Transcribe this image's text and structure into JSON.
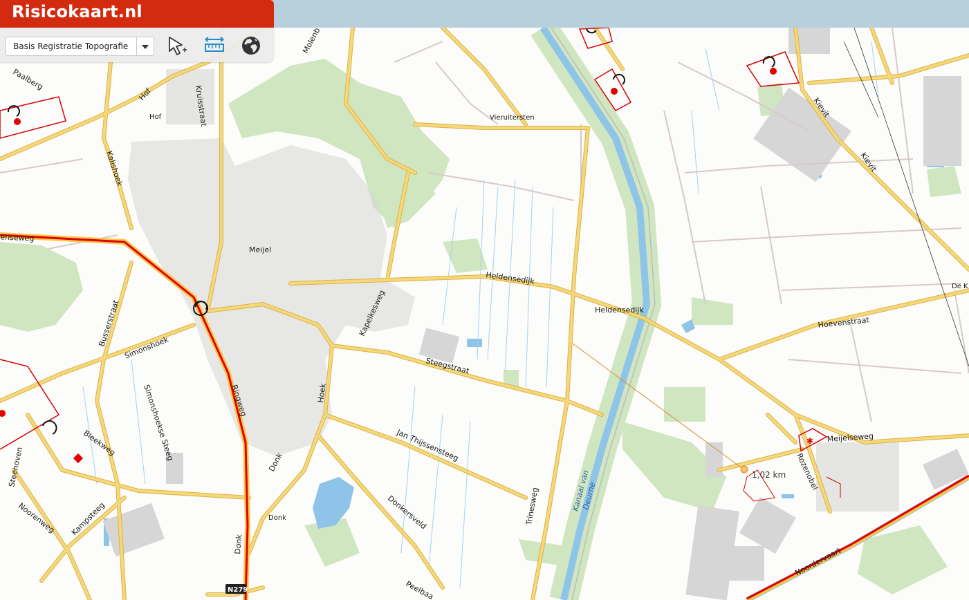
{
  "app": {
    "title": "Risicokaart.nl"
  },
  "toolbar": {
    "layer_select": {
      "value": "Basis Registratie Topografie"
    },
    "tools": [
      {
        "name": "select-tool",
        "icon": "cursor-select-icon"
      },
      {
        "name": "measure-tool",
        "icon": "ruler-measure-icon"
      },
      {
        "name": "globe-tool",
        "icon": "globe-icon"
      }
    ]
  },
  "map": {
    "colors": {
      "road_major": "#f6d77a",
      "road_outline": "#d9b347",
      "risk_route": "#e30000",
      "risk_zone": "#d40000",
      "water": "#8ec4e8",
      "forest": "#cfe6c0",
      "built": "#d6d6d6",
      "measure": "#e08a2a"
    },
    "places": {
      "meijel": "Meijel",
      "hof": "Hof",
      "donk": "Donk",
      "vieruitersten": "Vieruitersten",
      "de_k": "De K"
    },
    "streets": {
      "paalberg": "Paalberg",
      "hof": "Hof",
      "kruisstraat": "Kruisstraat",
      "molenb": "Molenb",
      "kalishoek": "Kalishoek",
      "tenseweg": "tenseweg",
      "busserstraat": "Busserstraat",
      "simonshoek": "Simonshoek",
      "simonshoekse_steeg": "Simonshoekse Steeg",
      "bleekweg": "Bleekweg",
      "steenoven": "Steenoven",
      "noorenweg": "Noorenweg",
      "kampsteeg": "Kampsteeg",
      "ringweg": "Ringweg",
      "donk_road": "Donk",
      "donk_road2": "Donk",
      "hoek": "Hoek",
      "kapelkesweg": "Kapelkesweg",
      "heldensedijk": "Heldensedijk",
      "heldensedijk2": "Heldensedijk",
      "steegstraat": "Steegstraat",
      "jan_thijssensteeg": "Jan Thijssensteeg",
      "donkersveld": "Donkersveld",
      "peelbaan": "Peelbaa",
      "trinesweg": "Trinesweg",
      "hoevenstraat": "Hoevenstraat",
      "meijelseweg": "Meijelseweg",
      "rozenobel": "Rozenobel",
      "kievit": "Kievit",
      "kievit2": "Kievit",
      "noordervaart": "Noordervaart"
    },
    "water": {
      "kanaal_line1": "Kanaal van",
      "kanaal_line2": "Deurne"
    },
    "route_shield": "N279",
    "measurement": {
      "distance": "1,02 km"
    }
  }
}
